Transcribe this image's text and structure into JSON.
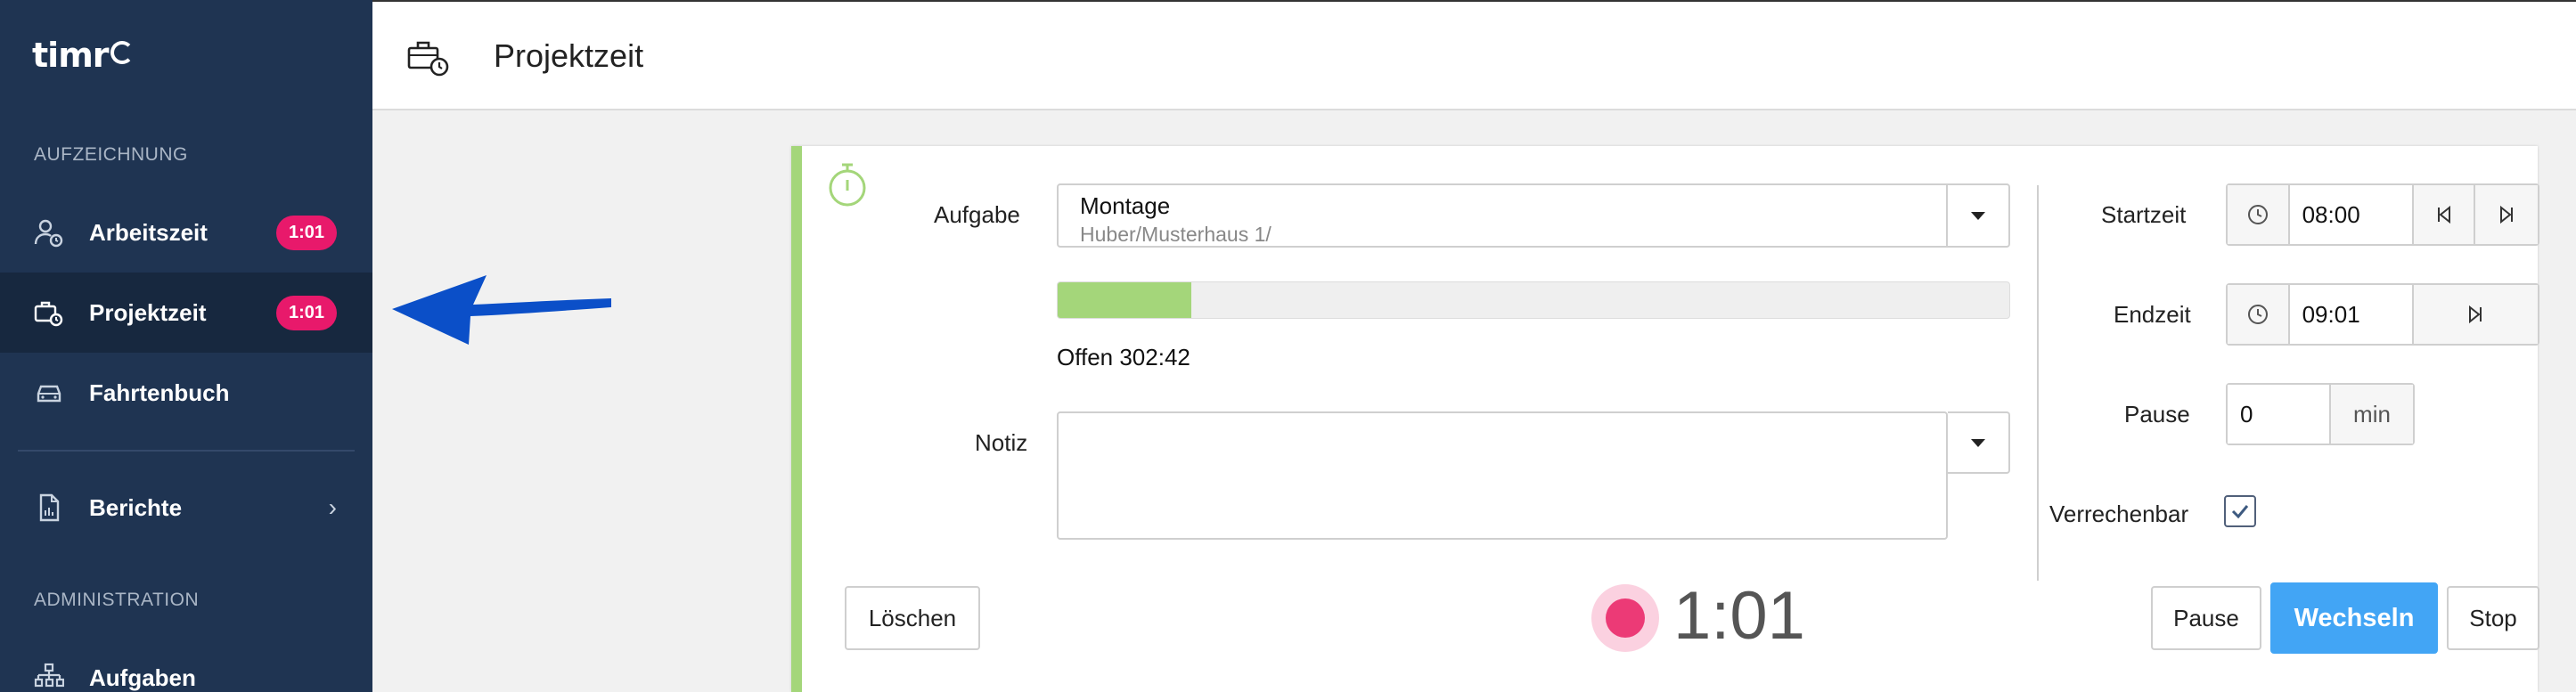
{
  "app": {
    "logo_text": "timr"
  },
  "sidebar": {
    "section_recording": "AUFZEICHNUNG",
    "section_admin": "ADMINISTRATION",
    "items": [
      {
        "label": "Arbeitszeit",
        "badge": "1:01"
      },
      {
        "label": "Projektzeit",
        "badge": "1:01"
      },
      {
        "label": "Fahrtenbuch"
      },
      {
        "label": "Berichte",
        "chevron": "›"
      },
      {
        "label": "Aufgaben"
      }
    ]
  },
  "header": {
    "title": "Projektzeit"
  },
  "form": {
    "task_label": "Aufgabe",
    "task_value": "Montage",
    "task_path": "Huber/Musterhaus 1/",
    "progress_fraction": 0.14,
    "open_text": "Offen 302:42",
    "note_label": "Notiz",
    "note_value": ""
  },
  "times": {
    "start_label": "Startzeit",
    "start_value": "08:00",
    "end_label": "Endzeit",
    "end_value": "09:01",
    "pause_label": "Pause",
    "pause_value": "0",
    "pause_unit": "min",
    "billable_label": "Verrechenbar",
    "billable_checked": true
  },
  "actions": {
    "delete": "Löschen",
    "timer": "1:01",
    "pause": "Pause",
    "switch": "Wechseln",
    "stop": "Stop"
  },
  "colors": {
    "sidebar_bg": "#1f3452",
    "badge": "#e8196b",
    "accent_green": "#a4d67a",
    "primary_blue": "#42a5f5",
    "record_red": "#ec3a76",
    "annotation_arrow": "#0b4fc8"
  }
}
